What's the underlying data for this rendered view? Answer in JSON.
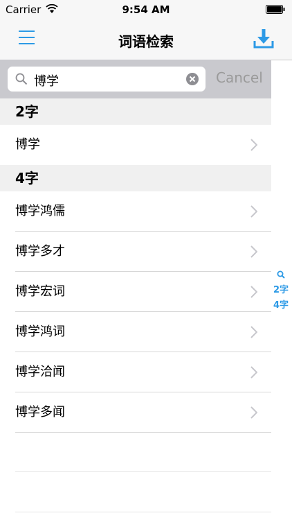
{
  "status_bar": {
    "carrier": "Carrier",
    "time": "9:54 AM"
  },
  "nav": {
    "title": "词语检索",
    "menu_icon": "menu-icon",
    "download_icon": "download-icon"
  },
  "search": {
    "value": "博学",
    "cancel_label": "Cancel"
  },
  "index": {
    "items": [
      "2字",
      "4字"
    ]
  },
  "sections": [
    {
      "header": "2字",
      "rows": [
        "博学"
      ]
    },
    {
      "header": "4字",
      "rows": [
        "博学鸿儒",
        "博学多才",
        "博学宏词",
        "博学鸿词",
        "博学洽闻",
        "博学多闻"
      ]
    }
  ],
  "colors": {
    "accent": "#2d9ae6",
    "bar_bg": "#f7f7f7",
    "search_bg": "#c9c9ce"
  }
}
